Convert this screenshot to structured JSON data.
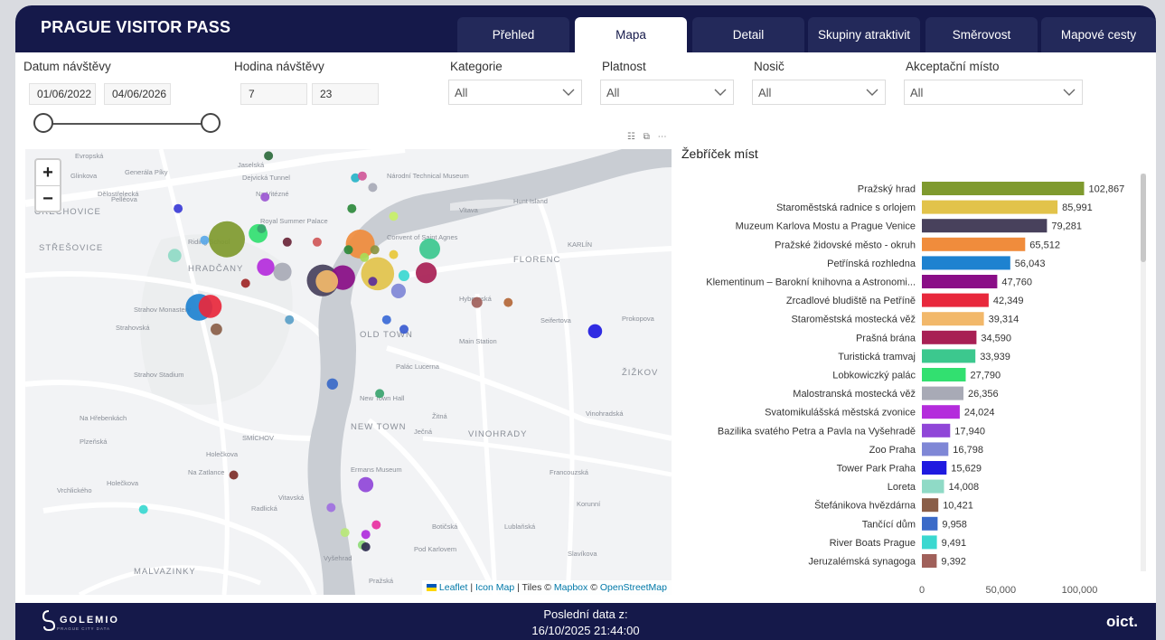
{
  "app": {
    "title": "PRAGUE VISITOR PASS"
  },
  "tabs": [
    {
      "label": "Přehled",
      "active": false
    },
    {
      "label": "Mapa",
      "active": true
    },
    {
      "label": "Detail",
      "active": false
    },
    {
      "label": "Skupiny atraktivit",
      "active": false
    },
    {
      "label": "Směrovost",
      "active": false
    },
    {
      "label": "Mapové cesty",
      "active": false
    }
  ],
  "filters": {
    "date": {
      "label": "Datum návštěvy",
      "from": "01/06/2022",
      "to": "04/06/2026"
    },
    "hour": {
      "label": "Hodina návštěvy",
      "from": "7",
      "to": "23"
    },
    "category": {
      "label": "Kategorie",
      "value": "All"
    },
    "validity": {
      "label": "Platnost",
      "value": "All"
    },
    "carrier": {
      "label": "Nosič",
      "value": "All"
    },
    "acceptance": {
      "label": "Akceptační místo",
      "value": "All"
    }
  },
  "map": {
    "zoom_in": "+",
    "zoom_out": "−",
    "attribution": {
      "leaflet": "Leaflet",
      "sep1": " | ",
      "iconmap": "Icon Map",
      "tiles": " | Tiles © ",
      "mapbox": "Mapbox",
      "osm_sep": " © ",
      "osm": "OpenStreetMap"
    },
    "labels": [
      "Evropská",
      "Glinkova",
      "Generála Píky",
      "Jaselská",
      "Dejvická Tunnel",
      "Na Vitézné",
      "Dělostřelecká",
      "OŘECHOVICE",
      "Pelléova",
      "Royal Summer Palace",
      "STŘEŠOVICE",
      "Riding School",
      "HRADČANY",
      "Strahov Monastery",
      "Strahovská",
      "Strahov Stadium",
      "Na Hřebenkách",
      "Vrchlického",
      "SMÍCHOV",
      "MALVAZINKY",
      "KARLÍN",
      "FLORENC",
      "Hunt Island",
      "Convent of Saint Agnes",
      "Hybernská",
      "OLD TOWN",
      "Main Station",
      "Palác Lucerna",
      "NEW TOWN",
      "VINOHRADY",
      "ŽIŽKOV",
      "New Town Hall",
      "Seifertova",
      "Prokopova",
      "Francouzská",
      "Korunní",
      "Vltava",
      "Ječná",
      "Žitná",
      "Ermans Museum",
      "Na Zatlance",
      "Holečkova",
      "Radlická",
      "Plzeňská",
      "Holečkova",
      "Vitavská",
      "Botičská",
      "Lublaňská",
      "Slavíkova",
      "Vinohradská",
      "Národní Technical Museum",
      "Pod Karlovem",
      "Pražská",
      "Vyšehrad"
    ],
    "points": [
      {
        "name": "Pražský hrad",
        "color": "#7f9a2e",
        "lat": 50.0906,
        "lon": 14.399,
        "value": 102867
      },
      {
        "name": "Staroměstská radnice s orlojem",
        "color": "#e2c34a",
        "lat": 50.087,
        "lon": 14.4207,
        "value": 85991
      },
      {
        "name": "Muzeum Karlova Mostu a Prague Venice",
        "color": "#48415c",
        "lat": 50.0863,
        "lon": 14.4128,
        "value": 79281
      },
      {
        "name": "Pražské židovské město - okruh",
        "color": "#f08c3c",
        "lat": 50.0901,
        "lon": 14.4182,
        "value": 65512
      },
      {
        "name": "Petřínská rozhledna",
        "color": "#1e82d0",
        "lat": 50.0835,
        "lon": 14.395,
        "value": 56043
      },
      {
        "name": "Klementinum",
        "color": "#8a0e87",
        "lat": 50.0866,
        "lon": 14.4157,
        "value": 47760
      },
      {
        "name": "Zrcadlové bludiště na Petříně",
        "color": "#e8283c",
        "lat": 50.0836,
        "lon": 14.3966,
        "value": 42349
      },
      {
        "name": "Staroměstská mostecká věž",
        "color": "#f2b86a",
        "lat": 50.0862,
        "lon": 14.4134,
        "value": 39314
      },
      {
        "name": "Prašná brána",
        "color": "#a81f54",
        "lat": 50.0871,
        "lon": 14.4277,
        "value": 34590
      },
      {
        "name": "Turistická tramvaj",
        "color": "#3cc88e",
        "lat": 50.0896,
        "lon": 14.4282,
        "value": 33939
      },
      {
        "name": "Lobkowiczký palác",
        "color": "#32e070",
        "lat": 50.0912,
        "lon": 14.4035,
        "value": 27790
      },
      {
        "name": "Malostranská mostecká věž",
        "color": "#a8aab6",
        "lat": 50.0872,
        "lon": 14.407,
        "value": 26356
      },
      {
        "name": "Svatomikulášská městská zvonice",
        "color": "#b42cdc",
        "lat": 50.0877,
        "lon": 14.4046,
        "value": 24024
      },
      {
        "name": "Bazilika sv. Petra a Pavla",
        "color": "#9046d8",
        "lat": 50.065,
        "lon": 14.419,
        "value": 17940
      },
      {
        "name": "Zoo Praha",
        "color": "#7f87d6",
        "lat": 50.0852,
        "lon": 14.4237,
        "value": 16798
      },
      {
        "name": "Tower Park Praha",
        "color": "#1f1ae0",
        "lat": 50.081,
        "lon": 14.452,
        "value": 15629
      },
      {
        "name": "Loreta",
        "color": "#8fdac6",
        "lat": 50.0889,
        "lon": 14.3915,
        "value": 14008
      },
      {
        "name": "Štefánikova hvězdárna",
        "color": "#8a5e48",
        "lat": 50.0812,
        "lon": 14.3975,
        "value": 10421
      },
      {
        "name": "Tančící dům",
        "color": "#3a6ac8",
        "lat": 50.0755,
        "lon": 14.4142,
        "value": 9958
      },
      {
        "name": "River Boats Prague",
        "color": "#3ad8d0",
        "lat": 50.0868,
        "lon": 14.4245,
        "value": 9491
      },
      {
        "name": "Jeruzalémská synagoga",
        "color": "#a0605a",
        "lat": 50.084,
        "lon": 14.435,
        "value": 9392
      },
      {
        "name": "",
        "color": "#2e6b3c",
        "lat": 50.0993,
        "lon": 14.405,
        "value": 5000
      },
      {
        "name": "",
        "color": "#28b4c8",
        "lat": 50.097,
        "lon": 14.4175,
        "value": 4500
      },
      {
        "name": "",
        "color": "#d05898",
        "lat": 50.0972,
        "lon": 14.4185,
        "value": 4200
      },
      {
        "name": "",
        "color": "#9b57d1",
        "lat": 50.095,
        "lon": 14.4045,
        "value": 3500
      },
      {
        "name": "",
        "color": "#3b3bd6",
        "lat": 50.0938,
        "lon": 14.392,
        "value": 4000
      },
      {
        "name": "",
        "color": "#2e8a3c",
        "lat": 50.0938,
        "lon": 14.417,
        "value": 4500
      },
      {
        "name": "",
        "color": "#c8f068",
        "lat": 50.093,
        "lon": 14.423,
        "value": 3900
      },
      {
        "name": "",
        "color": "#3aa46e",
        "lat": 50.0917,
        "lon": 14.404,
        "value": 3600
      },
      {
        "name": "",
        "color": "#6a2638",
        "lat": 50.0903,
        "lon": 14.4077,
        "value": 3500
      },
      {
        "name": "",
        "color": "#5aa8e8",
        "lat": 50.0905,
        "lon": 14.3958,
        "value": 3200
      },
      {
        "name": "",
        "color": "#d05858",
        "lat": 50.0903,
        "lon": 14.412,
        "value": 3400
      },
      {
        "name": "",
        "color": "#2e8a3c",
        "lat": 50.0895,
        "lon": 14.4165,
        "value": 4000
      },
      {
        "name": "",
        "color": "#a8dc58",
        "lat": 50.0887,
        "lon": 14.4188,
        "value": 3800
      },
      {
        "name": "",
        "color": "#8a9440",
        "lat": 50.0895,
        "lon": 14.4203,
        "value": 3800
      },
      {
        "name": "",
        "color": "#e8c838",
        "lat": 50.089,
        "lon": 14.423,
        "value": 3800
      },
      {
        "name": "",
        "color": "#a02828",
        "lat": 50.086,
        "lon": 14.4017,
        "value": 3600
      },
      {
        "name": "",
        "color": "#5a2e9a",
        "lat": 50.0862,
        "lon": 14.42,
        "value": 3500
      },
      {
        "name": "",
        "color": "#3b6ad6",
        "lat": 50.0822,
        "lon": 14.422,
        "value": 3500
      },
      {
        "name": "",
        "color": "#5aa0c8",
        "lat": 50.0822,
        "lon": 14.408,
        "value": 3400
      },
      {
        "name": "",
        "color": "#3a5bd0",
        "lat": 50.0812,
        "lon": 14.4245,
        "value": 3300
      },
      {
        "name": "",
        "color": "#3aa46e",
        "lat": 50.0745,
        "lon": 14.421,
        "value": 3200
      },
      {
        "name": "",
        "color": "#a8aab6",
        "lat": 50.096,
        "lon": 14.42,
        "value": 3400
      },
      {
        "name": "",
        "color": "#b46838",
        "lat": 50.084,
        "lon": 14.4395,
        "value": 3400
      },
      {
        "name": "",
        "color": "#7e2e28",
        "lat": 50.066,
        "lon": 14.4,
        "value": 3400
      },
      {
        "name": "",
        "color": "#3ad8d0",
        "lat": 50.0624,
        "lon": 14.387,
        "value": 3000
      },
      {
        "name": "",
        "color": "#a070e0",
        "lat": 50.0626,
        "lon": 14.414,
        "value": 3100
      },
      {
        "name": "",
        "color": "#e830a0",
        "lat": 50.0608,
        "lon": 14.4205,
        "value": 3300
      },
      {
        "name": "",
        "color": "#b02cdc",
        "lat": 50.0598,
        "lon": 14.419,
        "value": 4500
      },
      {
        "name": "",
        "color": "#8fdc78",
        "lat": 50.0587,
        "lon": 14.4185,
        "value": 3000
      },
      {
        "name": "",
        "color": "#b8e878",
        "lat": 50.06,
        "lon": 14.416,
        "value": 3000
      },
      {
        "name": "",
        "color": "#2e2e4e",
        "lat": 50.0585,
        "lon": 14.419,
        "value": 3000
      }
    ]
  },
  "chart_data": {
    "type": "bar",
    "title": "Žebříček míst",
    "categories": [
      "Pražský hrad",
      "Staroměstská radnice s orlojem",
      "Muzeum Karlova Mostu a Prague Venice",
      "Pražské židovské město - okruh",
      "Petřínská rozhledna",
      "Klementinum – Barokní knihovna a Astronomi...",
      "Zrcadlové bludiště na Petříně",
      "Staroměstská mostecká věž",
      "Prašná brána",
      "Turistická tramvaj",
      "Lobkowiczký palác",
      "Malostranská mostecká věž",
      "Svatomikulášská městská zvonice",
      "Bazilika svatého Petra a Pavla na Vyšehradě",
      "Zoo Praha",
      "Tower Park Praha",
      "Loreta",
      "Štefánikova hvězdárna",
      "Tančící dům",
      "River Boats Prague",
      "Jeruzalémská synagoga"
    ],
    "values": [
      102867,
      85991,
      79281,
      65512,
      56043,
      47760,
      42349,
      39314,
      34590,
      33939,
      27790,
      26356,
      24024,
      17940,
      16798,
      15629,
      14008,
      10421,
      9958,
      9491,
      9392
    ],
    "value_labels": [
      "102,867",
      "85,991",
      "79,281",
      "65,512",
      "56,043",
      "47,760",
      "42,349",
      "39,314",
      "34,590",
      "33,939",
      "27,790",
      "26,356",
      "24,024",
      "17,940",
      "16,798",
      "15,629",
      "14,008",
      "10,421",
      "9,958",
      "9,491",
      "9,392"
    ],
    "colors": [
      "#7f9a2e",
      "#e2c34a",
      "#48415c",
      "#f08c3c",
      "#1e82d0",
      "#8a0e87",
      "#e8283c",
      "#f2b86a",
      "#a81f54",
      "#3cc88e",
      "#32e070",
      "#a8aab6",
      "#b42cdc",
      "#9046d8",
      "#7f87d6",
      "#1f1ae0",
      "#8fdac6",
      "#8a5e48",
      "#3a6ac8",
      "#3ad8d0",
      "#a0605a"
    ],
    "xlim": [
      0,
      110000
    ],
    "x_ticks": [
      0,
      50000,
      100000
    ],
    "x_tick_labels": [
      "0",
      "50,000",
      "100,000"
    ],
    "orientation": "horizontal",
    "grid": false,
    "legend": "none"
  },
  "footer": {
    "logo_text": "GOLEMIO",
    "logo_sub": "PRAGUE CITY DATA",
    "last_data_label": "Poslední data z:",
    "last_data_value": "16/10/2025 21:44:00",
    "brand": "oict."
  },
  "colors": {
    "header_bg": "#15194a",
    "tab_bg": "#23295a",
    "accent": "#ffffff"
  },
  "icons": [
    "filter-icon",
    "expand-icon",
    "more-icon",
    "chevron-down-icon"
  ]
}
